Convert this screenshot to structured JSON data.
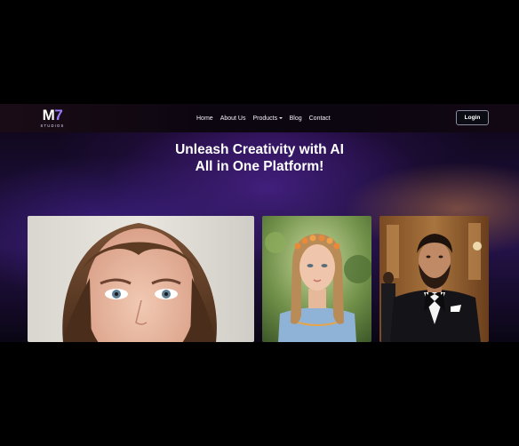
{
  "nav": {
    "logo": {
      "mark_main": "M",
      "mark_accent": "7",
      "subtitle": "STUDIOS"
    },
    "items": [
      {
        "label": "Home"
      },
      {
        "label": "About Us"
      },
      {
        "label": "Products",
        "has_dropdown": true
      },
      {
        "label": "Blog"
      },
      {
        "label": "Contact"
      }
    ],
    "login_label": "Login"
  },
  "hero": {
    "headline_line1": "Unleash Creativity with AI",
    "headline_line2": "All in One Platform!"
  },
  "gallery": {
    "images": [
      {
        "subject": "woman-portrait-closeup"
      },
      {
        "subject": "girl-braids-flower-crown"
      },
      {
        "subject": "man-in-tuxedo"
      }
    ]
  },
  "colors": {
    "background": "#000000",
    "accent_purple": "#9d7bff",
    "login_border": "#8a8aa0",
    "text": "#ffffff"
  }
}
